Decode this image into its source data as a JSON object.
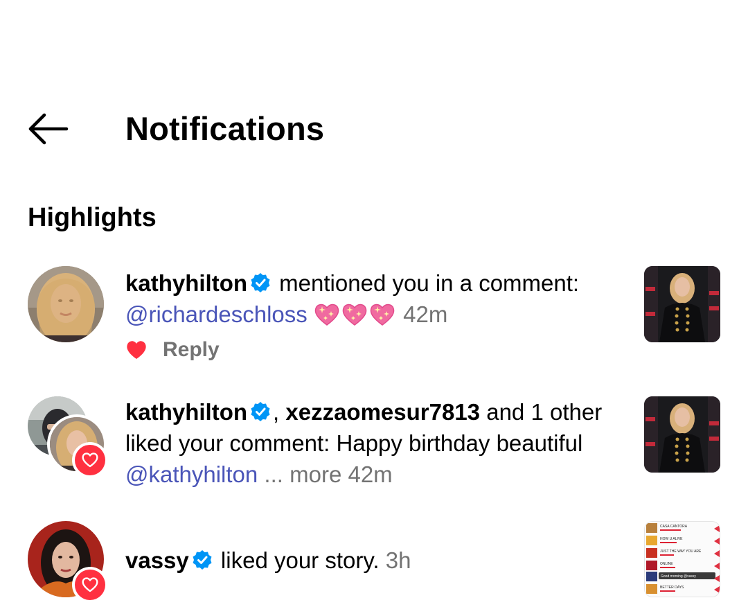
{
  "header": {
    "title": "Notifications",
    "back_icon": "arrow-left-icon"
  },
  "highlights": {
    "section_title": "Highlights"
  },
  "notifications": [
    {
      "username": "kathyhilton",
      "verified": true,
      "action_text": " mentioned you in a comment:",
      "mention": "@richardeschloss",
      "emojis": [
        "sparkling-heart-emoji",
        "sparkling-heart-emoji",
        "sparkling-heart-emoji"
      ],
      "time": "42m",
      "reply_label": "Reply",
      "liked": true
    },
    {
      "username": "kathyhilton",
      "verified": true,
      "separator": ",",
      "username2": "xezzaomesur7813",
      "action_text": " and 1 other liked your comment: Happy birthday beautiful ",
      "mention": "@kathyhilton",
      "more_label": " ... more",
      "time": "42m",
      "badge_icon": "heart-icon"
    },
    {
      "username": "vassy",
      "verified": true,
      "action_text": " liked your story.",
      "time": "3h",
      "badge_icon": "heart-icon"
    }
  ],
  "story_thumbnail": {
    "rows": [
      "CASA CANTORA",
      "HOW U ALIVE",
      "JUST THE WAY YOU ARE",
      "ONLINE",
      "Good morning @vassy",
      "BETTER DAYS"
    ]
  },
  "colors": {
    "accent_link": "#4a55b8",
    "heart_red": "#ff3040",
    "verified_blue": "#0095f6",
    "muted_text": "#737373"
  }
}
